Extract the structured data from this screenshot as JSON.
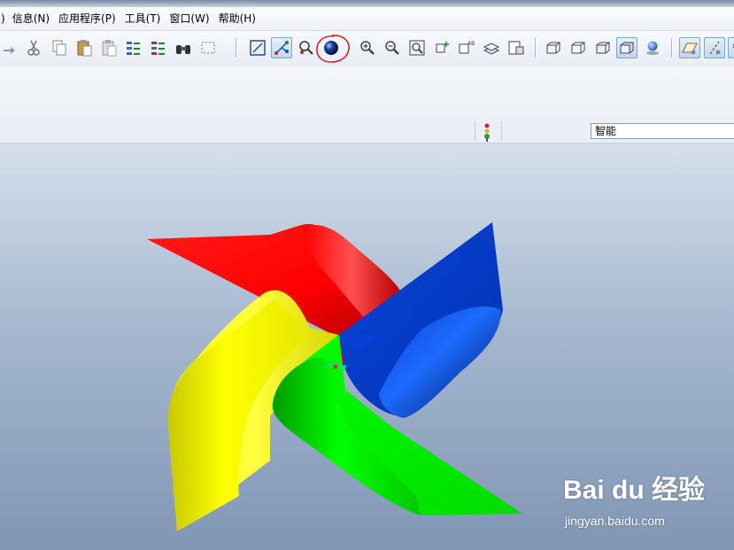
{
  "menu": {
    "items": [
      {
        "label": ")"
      },
      {
        "label": "信息(N)"
      },
      {
        "label": "应用程序(P)"
      },
      {
        "label": "工具(T)"
      },
      {
        "label": "窗口(W)"
      },
      {
        "label": "帮助(H)"
      }
    ]
  },
  "toolbar": {
    "buttons": [
      "arrow-icon",
      "cut-icon",
      "copy-icon",
      "paste-icon",
      "paste-special-icon",
      "regenerate-icon",
      "regenerate-manager-icon",
      "find-icon",
      "select-box-icon",
      "redraw-icon",
      "spin-center-icon",
      "orient-mode-icon",
      "shading-sphere-icon",
      "zoom-in-icon",
      "zoom-out-icon",
      "refit-icon",
      "reorient-icon",
      "saved-views-icon",
      "layers-icon",
      "view-manager-icon",
      "wireframe-icon",
      "hidden-line-icon",
      "no-hidden-icon",
      "shading-icon",
      "enhanced-realism-icon",
      "datum-planes-icon",
      "datum-axes-icon",
      "datum-points-icon"
    ],
    "highlighted": "shading-sphere-icon",
    "annotation_color": "#e31e24"
  },
  "status": {
    "filter_value": "智能"
  },
  "model": {
    "blade_colors": {
      "red": "#ff0000",
      "blue": "#0a3fd6",
      "yellow": "#ffff00",
      "green": "#00ee00"
    }
  },
  "watermark": {
    "brand": "Bai du 经验",
    "url": "jingyan.baidu.com"
  }
}
